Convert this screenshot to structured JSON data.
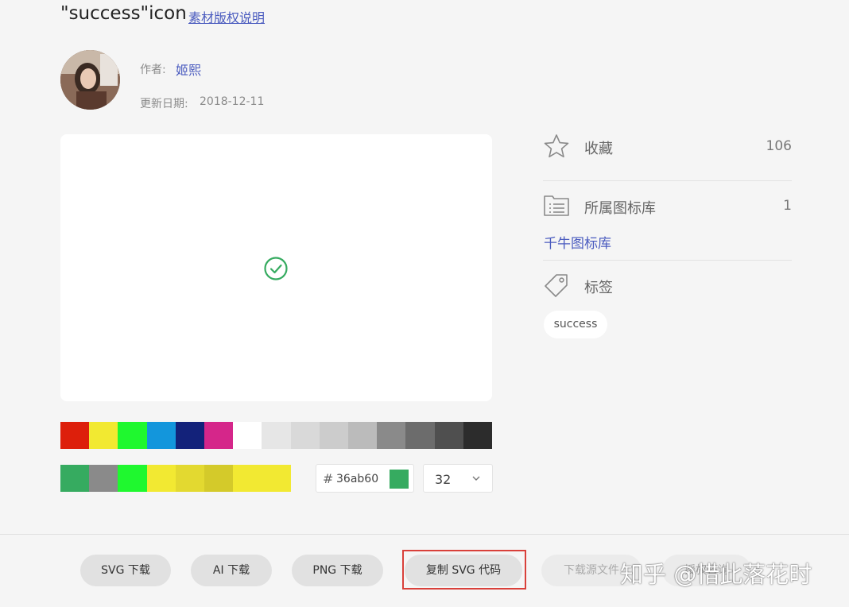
{
  "header": {
    "title": "\"success\"icon",
    "license_link": "素材版权说明"
  },
  "author": {
    "label": "作者:",
    "name": "姬熙",
    "date_label": "更新日期:",
    "date": "2018-12-11"
  },
  "preview": {
    "icon_color": "#36ab60"
  },
  "color_palette": {
    "row1": [
      "#dd1f0b",
      "#f2e931",
      "#1ff82f",
      "#1396dc",
      "#13227a",
      "#d5268a",
      "#ffffff",
      "#e6e6e6",
      "#d9d9d9",
      "#cccccc",
      "#bbbbbb",
      "#8a8a8a",
      "#6c6c6c",
      "#4f4f4f",
      "#2c2c2c"
    ],
    "row2": [
      "#36ab60",
      "#8a8a8a",
      "#1ff82f",
      "#f2e932",
      "#e3d930",
      "#d4ca2a",
      "#f2e932",
      "#f2e932"
    ]
  },
  "color_input": {
    "hash": "#",
    "value": "36ab60",
    "swatch_color": "#36ab60"
  },
  "size_select": {
    "value": "32"
  },
  "sidebar": {
    "favorites": {
      "label": "收藏",
      "count": "106"
    },
    "library": {
      "label": "所属图标库",
      "count": "1",
      "link": "千牛图标库"
    },
    "tags": {
      "label": "标签",
      "items": [
        "success"
      ]
    }
  },
  "actions": {
    "svg_download": "SVG 下载",
    "ai_download": "AI 下载",
    "png_download": "PNG 下载",
    "copy_svg": "复制 SVG 代码",
    "source_download": "下载源文件",
    "license_consult": "授权咨询"
  },
  "watermark": "知乎 @惜此落花时"
}
